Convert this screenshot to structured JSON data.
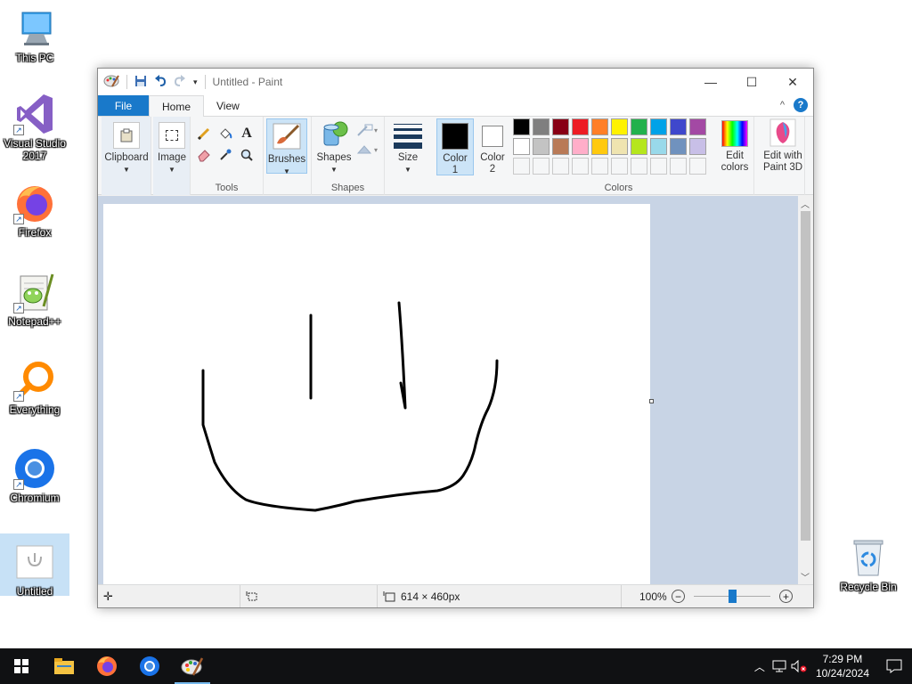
{
  "desktop": {
    "icons": [
      {
        "label": "This PC",
        "icon": "computer-icon"
      },
      {
        "label": "Visual Studio 2017",
        "icon": "visual-studio-icon"
      },
      {
        "label": "Firefox",
        "icon": "firefox-icon"
      },
      {
        "label": "Notepad++",
        "icon": "notepadpp-icon"
      },
      {
        "label": "Everything",
        "icon": "everything-icon"
      },
      {
        "label": "Chromium",
        "icon": "chromium-icon"
      },
      {
        "label": "Untitled",
        "icon": "paint-file-icon"
      },
      {
        "label": "Recycle Bin",
        "icon": "recycle-bin-icon"
      }
    ]
  },
  "window": {
    "title": "Untitled - Paint",
    "controls": {
      "minimize": "—",
      "maximize": "☐",
      "close": "✕"
    }
  },
  "tabs": {
    "file": "File",
    "home": "Home",
    "view": "View",
    "collapse": "^",
    "help": "?"
  },
  "ribbon": {
    "clipboard": {
      "label": "Clipboard"
    },
    "image": {
      "label": "Image"
    },
    "tools": {
      "group_label": "Tools",
      "items": [
        "pencil-icon",
        "fill-icon",
        "text-icon",
        "eraser-icon",
        "color-picker-icon",
        "magnifier-icon"
      ],
      "text_glyph": "A"
    },
    "brushes": {
      "label": "Brushes"
    },
    "shapes": {
      "label": "Shapes",
      "group_label": "Shapes"
    },
    "size": {
      "label": "Size"
    },
    "color1": {
      "label_line1": "Color",
      "label_line2": "1",
      "value": "#000000"
    },
    "color2": {
      "label_line1": "Color",
      "label_line2": "2",
      "value": "#ffffff"
    },
    "colors_group_label": "Colors",
    "palette_row1": [
      "#000000",
      "#7f7f7f",
      "#880015",
      "#ed1c24",
      "#ff7f27",
      "#fff200",
      "#22b14c",
      "#00a2e8",
      "#3f48cc",
      "#a349a4"
    ],
    "palette_row2": [
      "#ffffff",
      "#c3c3c3",
      "#b97a57",
      "#ffaec9",
      "#ffc90e",
      "#efe4b0",
      "#b5e61d",
      "#99d9ea",
      "#7092be",
      "#c8bfe7"
    ],
    "edit_colors": {
      "line1": "Edit",
      "line2": "colors"
    },
    "edit_paint3d": {
      "line1": "Edit with",
      "line2": "Paint 3D"
    }
  },
  "status": {
    "canvas_size": "614 × 460px",
    "zoom": "100%",
    "zoom_level": 100
  },
  "taskbar": {
    "apps": [
      "windows-start-icon",
      "file-explorer-icon",
      "firefox-icon",
      "chromium-icon",
      "paint-icon"
    ],
    "time": "7:29 PM",
    "date": "10/24/2024"
  }
}
